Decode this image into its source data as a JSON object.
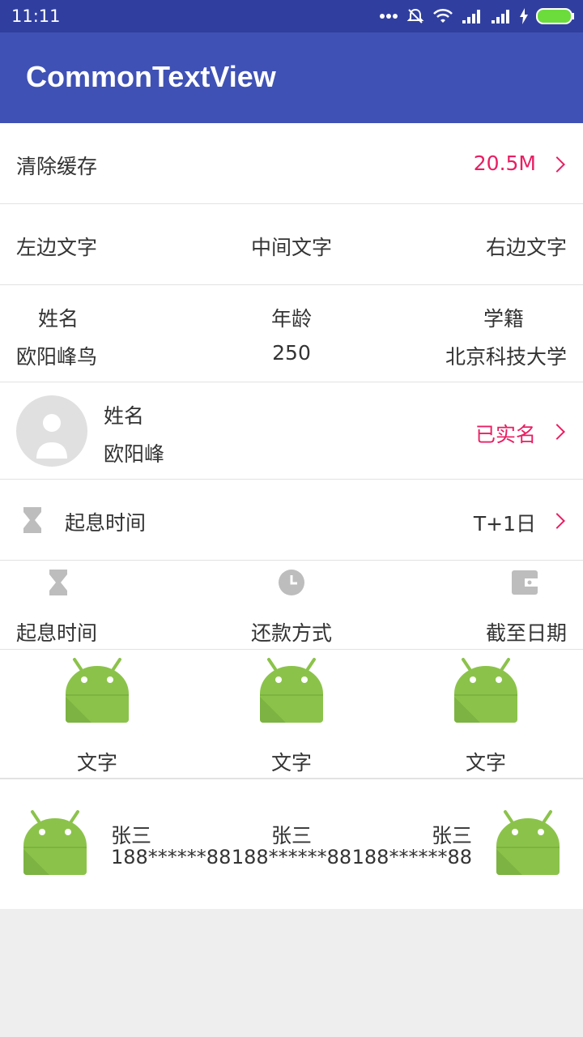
{
  "status_bar": {
    "time": "11:11"
  },
  "app_bar": {
    "title": "CommonTextView"
  },
  "rows": {
    "cache": {
      "label": "清除缓存",
      "value": "20.5M"
    },
    "three_text": {
      "left": "左边文字",
      "center": "中间文字",
      "right": "右边文字"
    },
    "info": {
      "headers": [
        "姓名",
        "年龄",
        "学籍"
      ],
      "values": [
        "欧阳峰鸟",
        "250",
        "北京科技大学"
      ]
    },
    "profile": {
      "name_label": "姓名",
      "name_value": "欧阳峰",
      "status": "已实名"
    },
    "interest": {
      "label": "起息时间",
      "value": "T+1日"
    },
    "icon_labels": {
      "left": "起息时间",
      "center": "还款方式",
      "right": "截至日期"
    },
    "android_items": [
      "文字",
      "文字",
      "文字"
    ],
    "contacts": [
      {
        "name": "张三",
        "phone": "188******88"
      },
      {
        "name": "张三",
        "phone": "188******88"
      },
      {
        "name": "张三",
        "phone": "188******88"
      }
    ]
  },
  "colors": {
    "primary": "#3f51b5",
    "status_bar": "#303f9f",
    "accent": "#e91e63",
    "android_green": "#8bc34a"
  }
}
